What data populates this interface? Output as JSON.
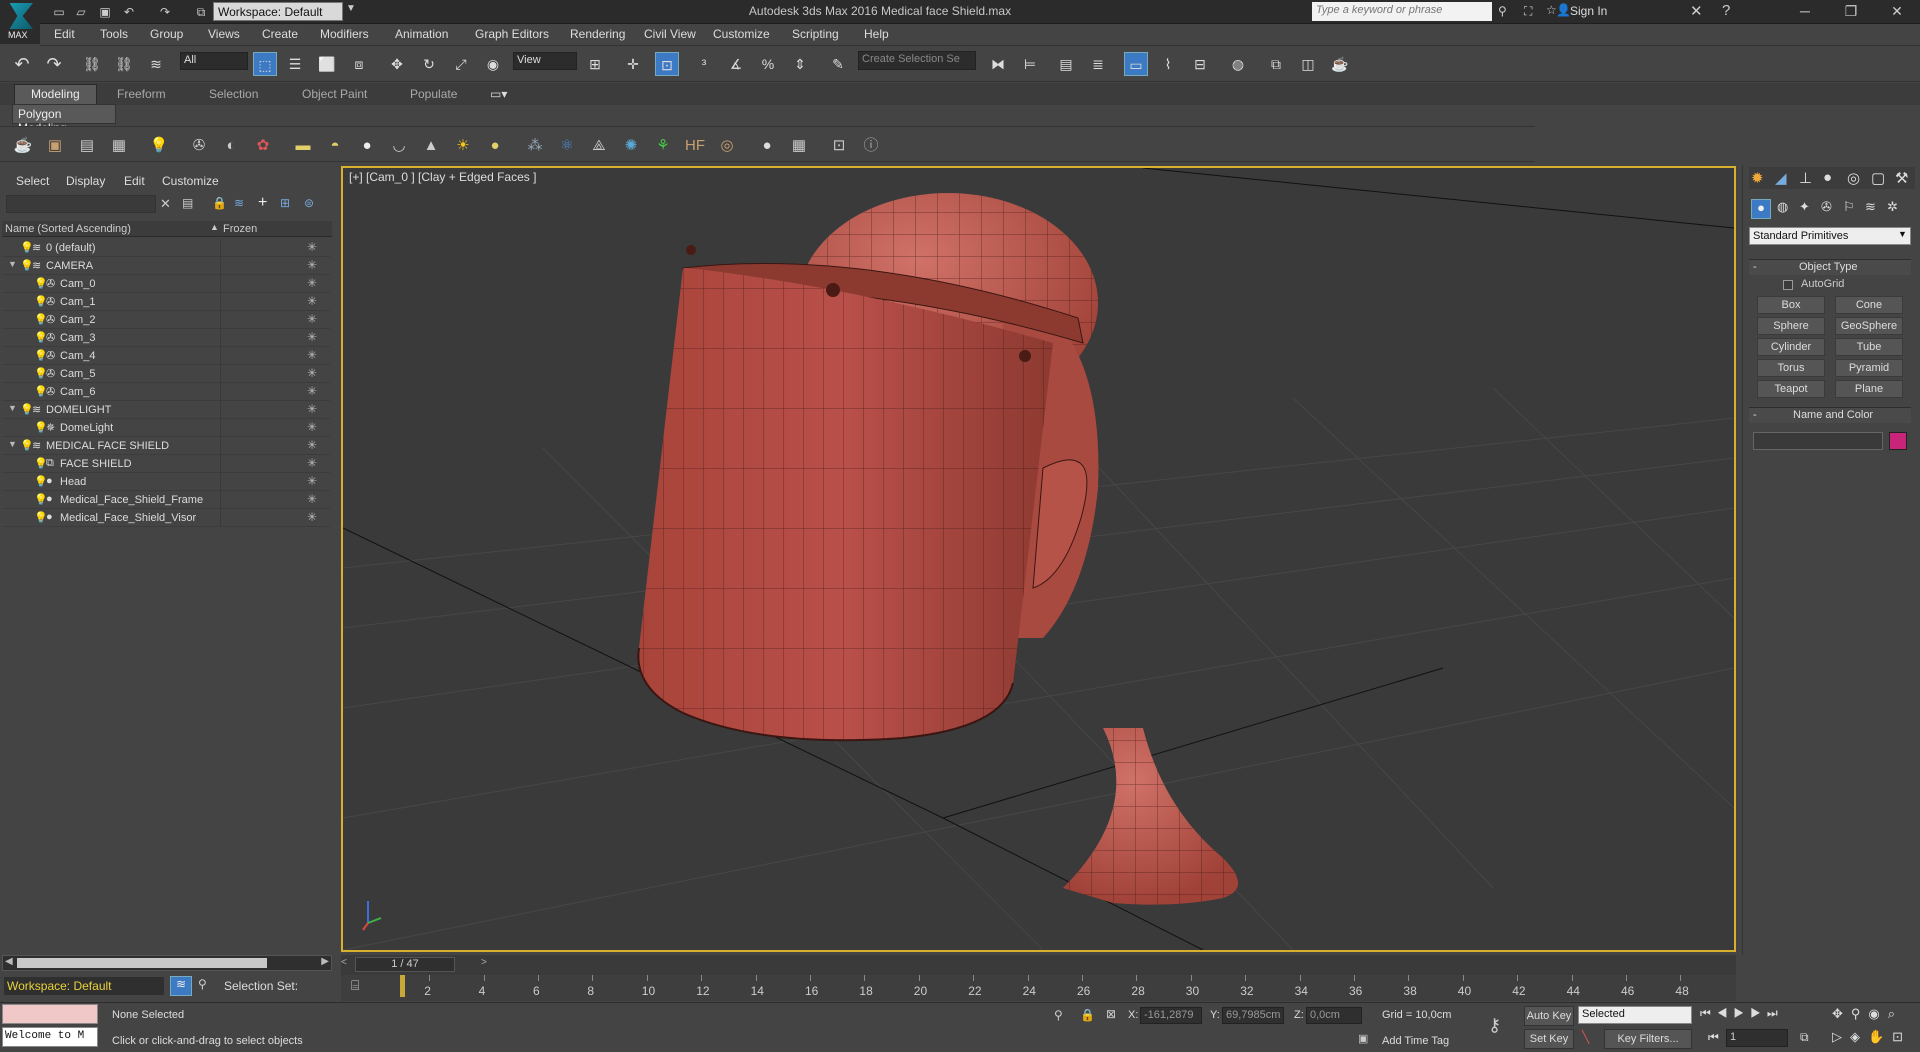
{
  "app": {
    "title": "Autodesk 3ds Max 2016     Medical face Shield.max",
    "logo_text": "MAX",
    "workspace_label": "Workspace: Default",
    "search_placeholder": "Type a keyword or phrase",
    "sign_in": "Sign In"
  },
  "menu": [
    "Edit",
    "Tools",
    "Group",
    "Views",
    "Create",
    "Modifiers",
    "Animation",
    "Graph Editors",
    "Rendering",
    "Civil View",
    "Customize",
    "Scripting",
    "Help"
  ],
  "toolbar": {
    "selection_filter": "All",
    "reference_coord": "View",
    "named_selection_placeholder": "Create Selection Se"
  },
  "ribbon": {
    "tabs": [
      "Modeling",
      "Freeform",
      "Selection",
      "Object Paint",
      "Populate"
    ],
    "active_tab": "Modeling",
    "panel_label": "Polygon Modeling"
  },
  "explorer": {
    "menu": [
      "Select",
      "Display",
      "Edit",
      "Customize"
    ],
    "col_name": "Name (Sorted Ascending)",
    "col_frozen": "Frozen",
    "rows": [
      {
        "label": "0 (default)",
        "type": "layer",
        "depth": 1,
        "expand": ""
      },
      {
        "label": "CAMERA",
        "type": "layer",
        "depth": 1,
        "expand": "▼"
      },
      {
        "label": "Cam_0",
        "type": "camera",
        "depth": 2,
        "expand": ""
      },
      {
        "label": "Cam_1",
        "type": "camera",
        "depth": 2,
        "expand": ""
      },
      {
        "label": "Cam_2",
        "type": "camera",
        "depth": 2,
        "expand": ""
      },
      {
        "label": "Cam_3",
        "type": "camera",
        "depth": 2,
        "expand": ""
      },
      {
        "label": "Cam_4",
        "type": "camera",
        "depth": 2,
        "expand": ""
      },
      {
        "label": "Cam_5",
        "type": "camera",
        "depth": 2,
        "expand": ""
      },
      {
        "label": "Cam_6",
        "type": "camera",
        "depth": 2,
        "expand": ""
      },
      {
        "label": "DOMELIGHT",
        "type": "layer",
        "depth": 1,
        "expand": "▼"
      },
      {
        "label": "DomeLight",
        "type": "light",
        "depth": 2,
        "expand": ""
      },
      {
        "label": "MEDICAL FACE SHIELD",
        "type": "layer",
        "depth": 1,
        "expand": "▼"
      },
      {
        "label": "FACE SHIELD",
        "type": "group",
        "depth": 2,
        "expand": ""
      },
      {
        "label": "Head",
        "type": "object",
        "depth": 2,
        "expand": ""
      },
      {
        "label": "Medical_Face_Shield_Frame",
        "type": "object",
        "depth": 2,
        "expand": ""
      },
      {
        "label": "Medical_Face_Shield_Visor",
        "type": "object",
        "depth": 2,
        "expand": ""
      }
    ]
  },
  "viewport": {
    "label": "[+] [Cam_0 ] [Clay + Edged Faces ]"
  },
  "command_panel": {
    "dropdown": "Standard Primitives",
    "object_type_title": "Object Type",
    "autogrid": "AutoGrid",
    "buttons": [
      "Box",
      "Cone",
      "Sphere",
      "GeoSphere",
      "Cylinder",
      "Tube",
      "Torus",
      "Pyramid",
      "Teapot",
      "Plane"
    ],
    "name_color_title": "Name and Color",
    "object_color": "#c8247a"
  },
  "timeline": {
    "frame_counter": "1 / 47",
    "ticks": [
      2,
      4,
      6,
      8,
      10,
      12,
      14,
      16,
      18,
      20,
      22,
      24,
      26,
      28,
      30,
      32,
      34,
      36,
      38,
      40,
      42,
      44,
      46,
      48
    ]
  },
  "status": {
    "workspace": "Workspace: Default",
    "selection_set": "Selection Set:",
    "listener": "Welcome to M",
    "selection": "None Selected",
    "prompt": "Click or click-and-drag to select objects",
    "x": "-161,2879",
    "y": "69,7985cm",
    "z": "0,0cm",
    "grid": "Grid = 10,0cm",
    "add_time_tag": "Add Time Tag",
    "auto_key": "Auto Key",
    "set_key": "Set Key",
    "key_mode": "Selected",
    "key_filters": "Key Filters...",
    "current_frame": "1",
    "x_label": "X:",
    "y_label": "Y:",
    "z_label": "Z:"
  },
  "colors": {
    "viewport_border": "#d7b02e",
    "model_red": "#b84a3c",
    "bulb": "#e8d33a"
  }
}
